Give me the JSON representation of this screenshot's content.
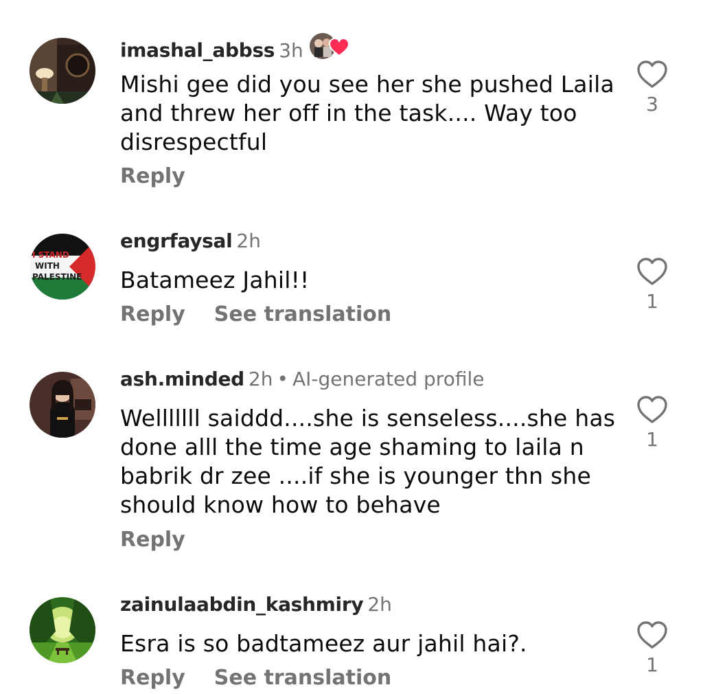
{
  "comments": [
    {
      "username": "imashal_abbss",
      "time": "3h",
      "label": "",
      "text": "Mishi gee did you see her she pushed Laila and threw her off in the task.... Way too disrespectful",
      "reply": "Reply",
      "translation": "",
      "likes": "3",
      "avatar_icon": "profile-photo-room",
      "reaction_icon": "creator-heart-icon"
    },
    {
      "username": "engrfaysal",
      "time": "2h",
      "label": "",
      "text": "Batameez Jahil!!",
      "reply": "Reply",
      "translation": "See translation",
      "likes": "1",
      "avatar_icon": "profile-flag-badge",
      "avatar_text": [
        "I STAND",
        "WITH",
        "PALESTINE"
      ]
    },
    {
      "username": "ash.minded",
      "time": "2h",
      "label": "AI-generated profile",
      "text": "Welllllll saiddd....she is senseless....she has done alll the time age shaming to laila n babrik dr zee ....if she is younger thn she should know how to behave",
      "reply": "Reply",
      "translation": "",
      "likes": "1",
      "avatar_icon": "profile-photo-woman"
    },
    {
      "username": "zainulaabdin_kashmiry",
      "time": "2h",
      "label": "",
      "text": "Esra is so badtameez aur jahil hai?.",
      "reply": "Reply",
      "translation": "See translation",
      "likes": "1",
      "avatar_icon": "profile-photo-forest"
    }
  ],
  "colors": {
    "secondary_text": "#737373",
    "primary_text": "#0a0a0a",
    "heart_red": "#ff2d55"
  }
}
